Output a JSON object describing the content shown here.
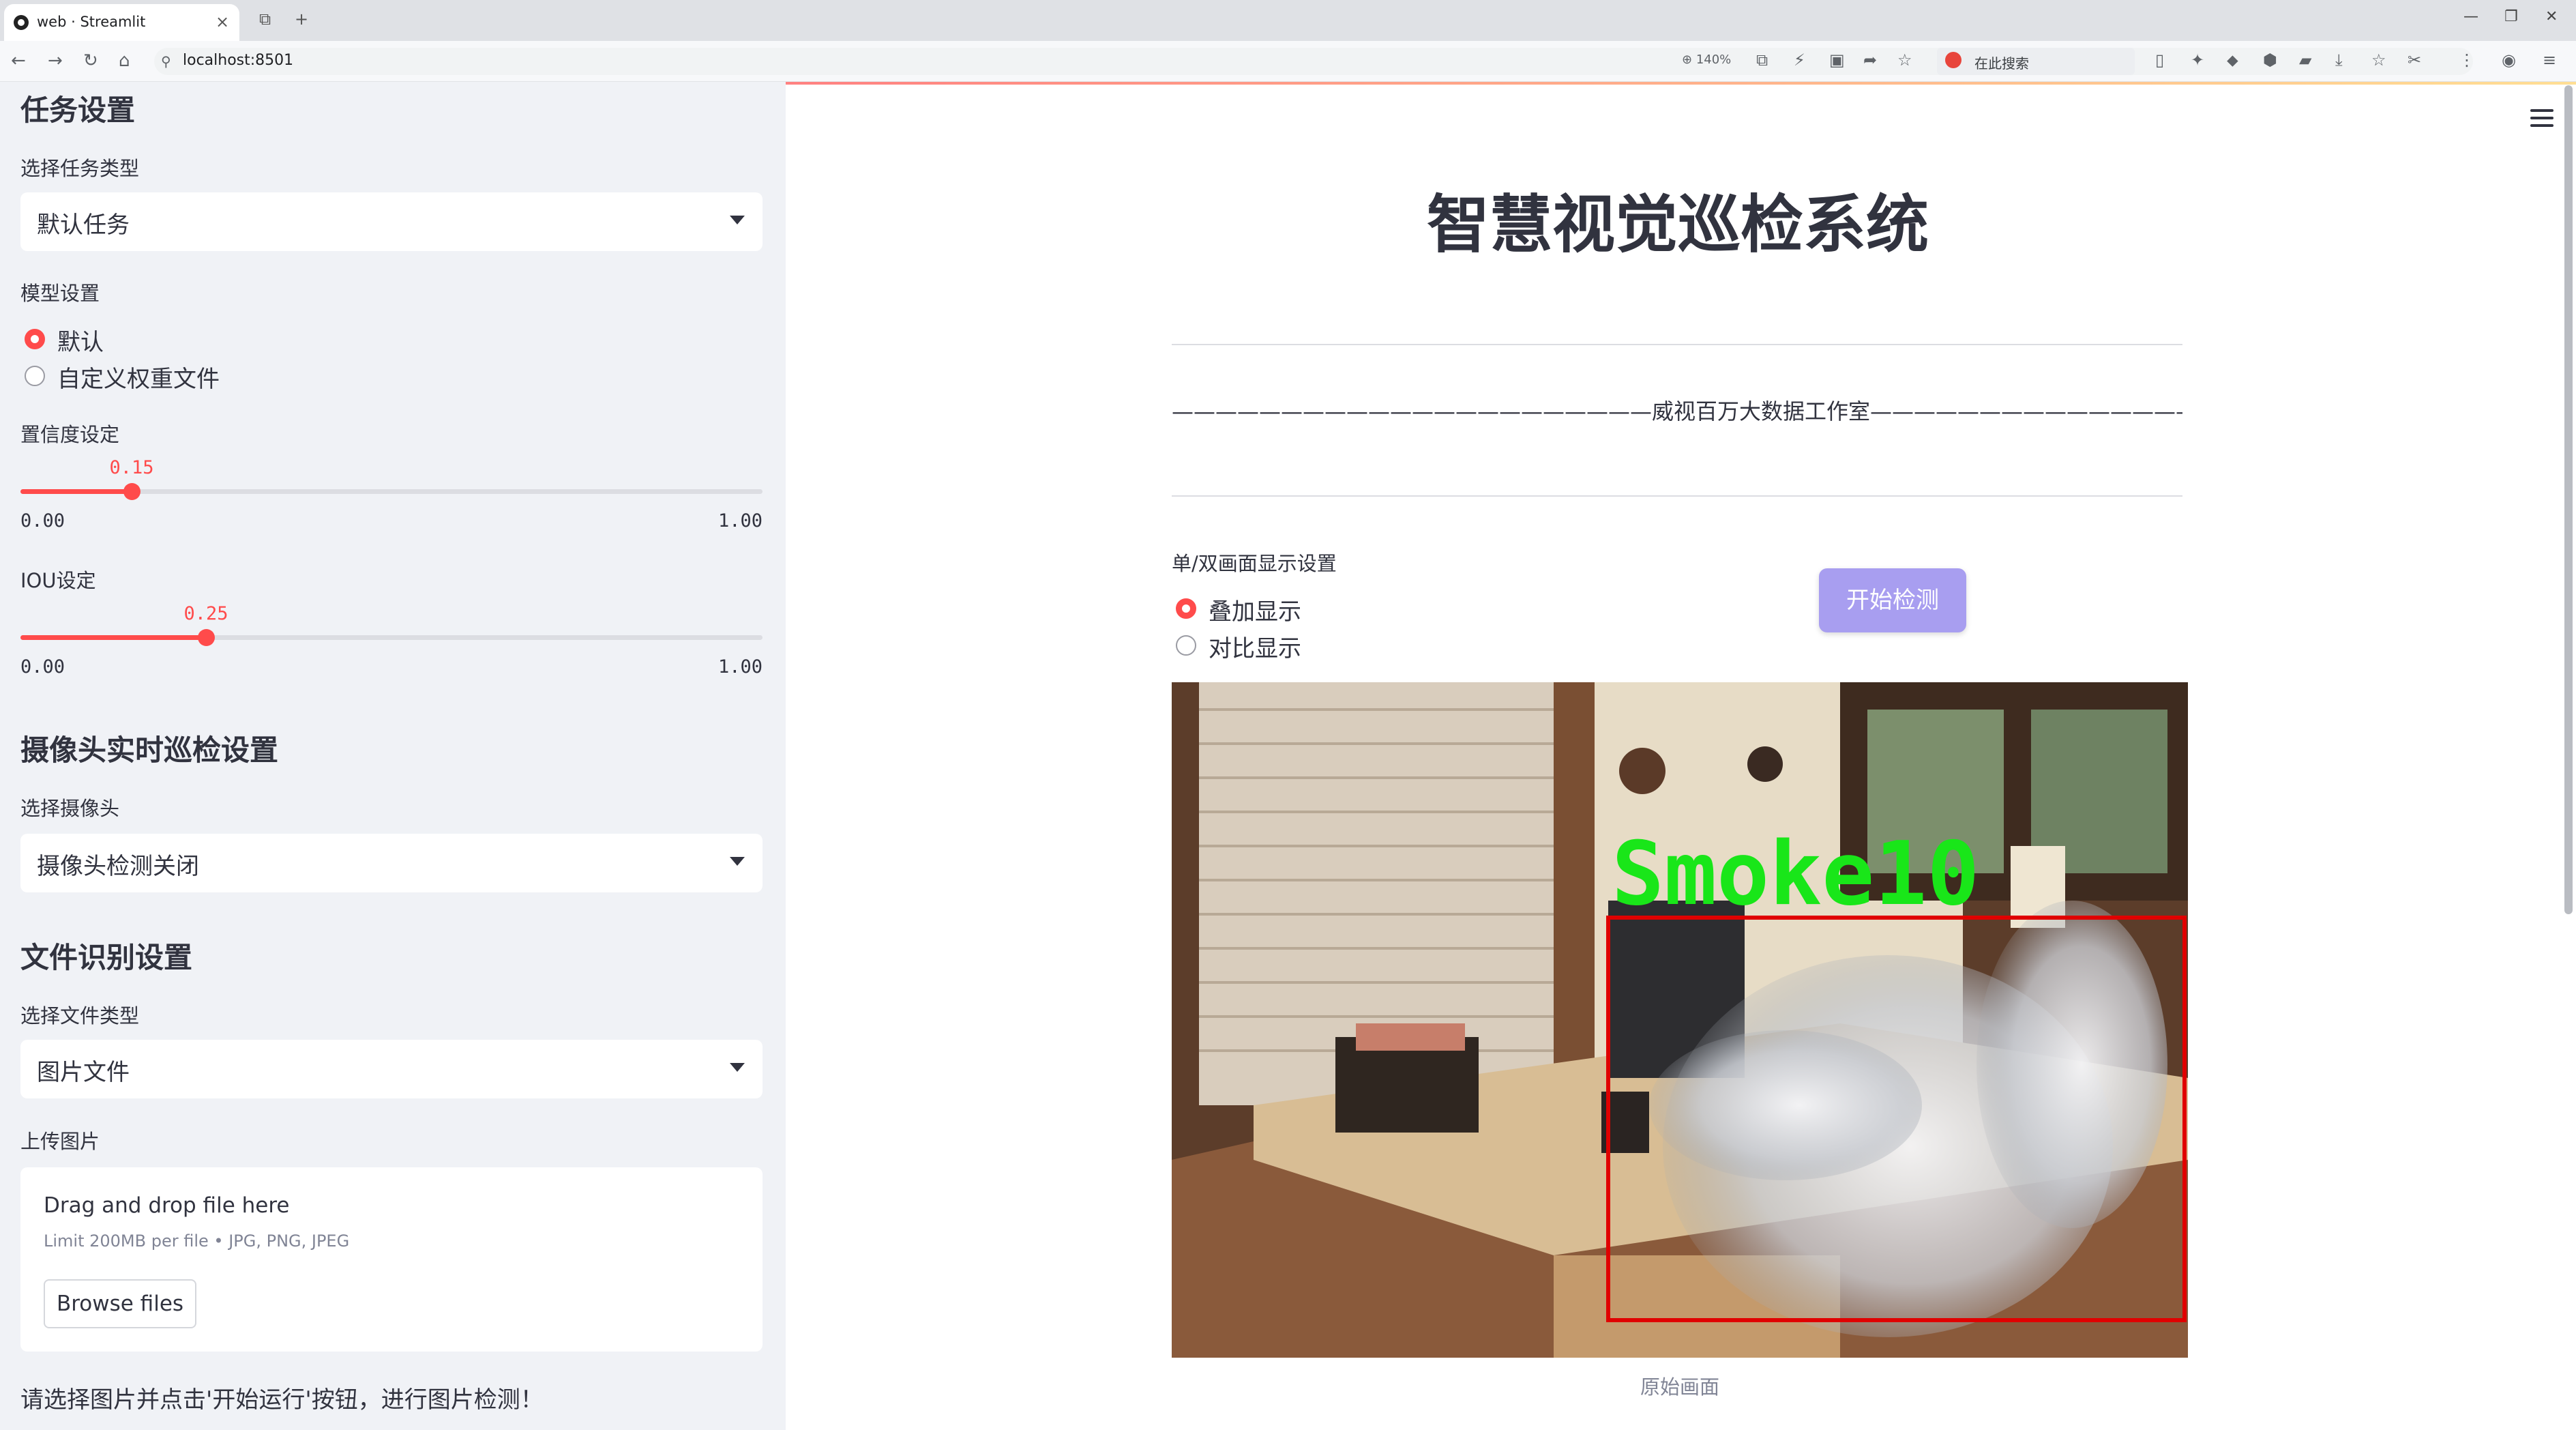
{
  "browser": {
    "tab_title": "web · Streamlit",
    "url": "localhost:8501",
    "zoom": "140%",
    "search_label": "在此搜索",
    "tab_close": "×",
    "new_tab": "+"
  },
  "sidebar": {
    "task_section_title": "任务设置",
    "task_type_label": "选择任务类型",
    "task_type_value": "默认任务",
    "model_label": "模型设置",
    "model_options": [
      {
        "label": "默认",
        "selected": true
      },
      {
        "label": "自定义权重文件",
        "selected": false
      }
    ],
    "confidence": {
      "label": "置信度设定",
      "value": 0.15,
      "value_text": "0.15",
      "min": "0.00",
      "max": "1.00"
    },
    "iou": {
      "label": "IOU设定",
      "value": 0.25,
      "value_text": "0.25",
      "min": "0.00",
      "max": "1.00"
    },
    "camera_section_title": "摄像头实时巡检设置",
    "camera_label": "选择摄像头",
    "camera_value": "摄像头检测关闭",
    "file_section_title": "文件识别设置",
    "file_type_label": "选择文件类型",
    "file_type_value": "图片文件",
    "upload_label": "上传图片",
    "upload": {
      "title": "Drag and drop file here",
      "limit": "Limit 200MB per file • JPG, PNG, JPEG",
      "button": "Browse files"
    },
    "hint": "请选择图片并点击'开始运行'按钮，进行图片检测！"
  },
  "main": {
    "title": "智慧视觉巡检系统",
    "studio_line": "——————————————————————威视百万大数据工作室————————————————————————",
    "display_label": "单/双画面显示设置",
    "display_options": [
      {
        "label": "叠加显示",
        "selected": true
      },
      {
        "label": "对比显示",
        "selected": false
      }
    ],
    "start_button": "开始检测",
    "detection_label": "Smoke10",
    "image_caption": "原始画面"
  },
  "colors": {
    "accent": "#ff4b4b",
    "sidebar_bg": "#f0f2f6",
    "button": "#a89ef0",
    "detection_box": "#e00000",
    "detection_text": "#19e619"
  }
}
